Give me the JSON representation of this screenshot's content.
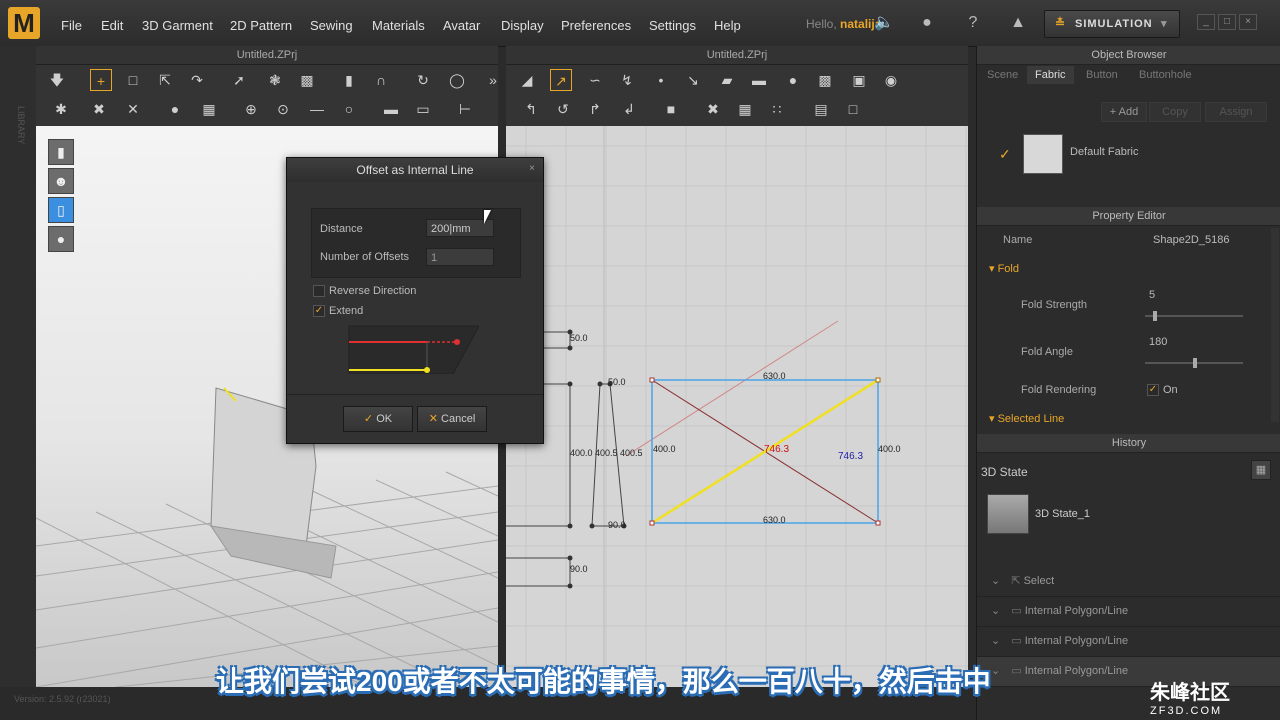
{
  "app": {
    "logo": "M",
    "hello": "Hello,",
    "user": "natalija",
    "sim_label": "SIMULATION"
  },
  "menu": [
    "File",
    "Edit",
    "3D Garment",
    "2D Pattern",
    "Sewing",
    "Materials",
    "Avatar",
    "Display",
    "Preferences",
    "Settings",
    "Help"
  ],
  "left_strip_label": "LIBRARY",
  "windows": {
    "left_title": "Untitled.ZPrj",
    "right_title": "Untitled.ZPrj"
  },
  "dialog": {
    "title": "Offset as Internal Line",
    "distance_label": "Distance",
    "distance_value": "200|mm",
    "offsets_label": "Number of Offsets",
    "offsets_value": "1",
    "reverse_label": "Reverse Direction",
    "extend_label": "Extend",
    "ok_label": "OK",
    "cancel_label": "Cancel",
    "reverse_checked": false,
    "extend_checked": true
  },
  "pattern_labels": {
    "a": "50.0",
    "b": "50.0",
    "c": "400.0",
    "d": "400.5",
    "e": "400.5",
    "f": "90.0",
    "g": "90.0",
    "top": "630.0",
    "bottom": "630.0",
    "left": "400.0",
    "right": "400.0",
    "diag_red": "746.3",
    "diag_blue": "746.3"
  },
  "object_browser": {
    "title": "Object Browser",
    "tabs": [
      "Scene",
      "Fabric",
      "Button",
      "Buttonhole"
    ],
    "active_tab": "Fabric",
    "add": "Add",
    "copy": "Copy",
    "assign": "Assign",
    "fabric_name": "Default Fabric"
  },
  "property_editor": {
    "title": "Property Editor",
    "name_label": "Name",
    "name_value": "Shape2D_5186",
    "fold_section": "Fold",
    "fold_strength_label": "Fold Strength",
    "fold_strength_value": "5",
    "fold_angle_label": "Fold Angle",
    "fold_angle_value": "180",
    "fold_rendering_label": "Fold Rendering",
    "fold_rendering_value": "On",
    "selected_line_section": "Selected Line"
  },
  "history": {
    "title": "History",
    "state_label": "3D State",
    "state_item": "3D State_1",
    "rows": [
      "Select",
      "Internal Polygon/Line",
      "Internal Polygon/Line",
      "Internal Polygon/Line"
    ]
  },
  "footer": {
    "version": "Version: 2.5.92    (r23021)"
  },
  "subtitle": "让我们尝试200或者不太可能的事情，那么一百八十，然后击中",
  "watermark": {
    "main": "朱峰社区",
    "sub": "ZF3D.COM"
  },
  "colors": {
    "accent": "#e8a629",
    "pattern_select": "#4aa3e8",
    "internal_line": "#f0e020",
    "diag_line": "#8a3030"
  }
}
